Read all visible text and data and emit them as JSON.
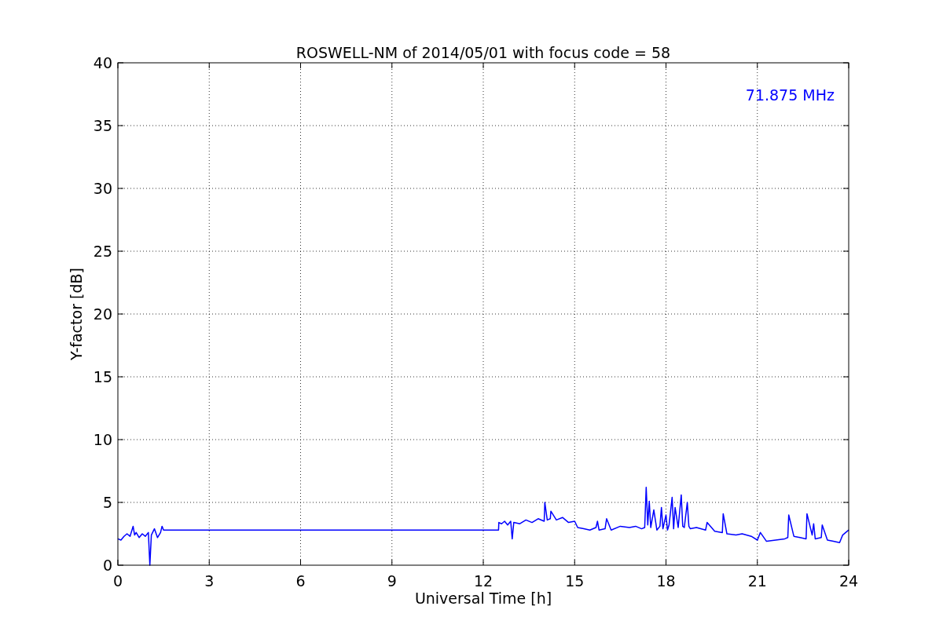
{
  "chart_data": {
    "type": "line",
    "title": "ROSWELL-NM of 2014/05/01 with focus code = 58",
    "xlabel": "Universal Time [h]",
    "ylabel": "Y-factor [dB]",
    "x": [
      0,
      0.1,
      0.2,
      0.3,
      0.4,
      0.5,
      0.55,
      0.6,
      0.7,
      0.8,
      0.9,
      1.0,
      1.05,
      1.1,
      1.2,
      1.3,
      1.4,
      1.45,
      1.5,
      12.5,
      12.51,
      12.6,
      12.7,
      12.8,
      12.9,
      12.95,
      13.0,
      13.2,
      13.4,
      13.6,
      13.8,
      14.0,
      14.02,
      14.1,
      14.2,
      14.22,
      14.4,
      14.6,
      14.8,
      15.0,
      15.1,
      15.3,
      15.5,
      15.7,
      15.75,
      15.8,
      16.0,
      16.05,
      16.2,
      16.5,
      16.8,
      17.0,
      17.2,
      17.3,
      17.35,
      17.4,
      17.45,
      17.5,
      17.6,
      17.7,
      17.8,
      17.85,
      17.9,
      18.0,
      18.05,
      18.1,
      18.2,
      18.25,
      18.3,
      18.4,
      18.5,
      18.55,
      18.6,
      18.7,
      18.75,
      18.8,
      19.0,
      19.3,
      19.35,
      19.6,
      19.85,
      19.88,
      20.0,
      20.3,
      20.5,
      20.8,
      21.0,
      21.1,
      21.3,
      21.6,
      21.9,
      22.0,
      22.03,
      22.2,
      22.4,
      22.6,
      22.63,
      22.8,
      22.85,
      22.9,
      23.1,
      23.13,
      23.3,
      23.5,
      23.7,
      23.8,
      24.0
    ],
    "series": [
      {
        "name": "71.875 MHz",
        "color": "#0000ff",
        "values": [
          2.1,
          2.0,
          2.3,
          2.5,
          2.3,
          3.1,
          2.4,
          2.6,
          2.2,
          2.5,
          2.3,
          2.6,
          0,
          2.4,
          2.9,
          2.2,
          2.6,
          3.1,
          2.8,
          2.8,
          3.4,
          3.3,
          3.5,
          3.2,
          3.5,
          2.1,
          3.4,
          3.3,
          3.6,
          3.4,
          3.7,
          3.5,
          5.0,
          3.6,
          3.7,
          4.3,
          3.6,
          3.8,
          3.4,
          3.5,
          3.0,
          2.9,
          2.8,
          3.0,
          3.5,
          2.8,
          2.9,
          3.7,
          2.8,
          3.1,
          3.0,
          3.1,
          2.9,
          3.0,
          6.2,
          3.2,
          5.1,
          3.0,
          4.4,
          2.8,
          3.1,
          4.6,
          2.9,
          4.0,
          2.8,
          3.2,
          5.4,
          2.9,
          4.6,
          3.0,
          5.6,
          3.1,
          3.0,
          5.0,
          3.1,
          2.9,
          3.0,
          2.8,
          3.4,
          2.7,
          2.6,
          4.1,
          2.5,
          2.4,
          2.5,
          2.3,
          2.0,
          2.6,
          1.9,
          2.0,
          2.1,
          2.2,
          4.0,
          2.3,
          2.2,
          2.1,
          4.1,
          2.4,
          3.3,
          2.1,
          2.2,
          3.2,
          2.0,
          1.9,
          1.8,
          2.4,
          2.8
        ]
      }
    ],
    "xlim": [
      0,
      24
    ],
    "ylim": [
      0,
      40
    ],
    "xticks": [
      0,
      3,
      6,
      9,
      12,
      15,
      18,
      21,
      24
    ],
    "yticks": [
      0,
      5,
      10,
      15,
      20,
      25,
      30,
      35,
      40
    ],
    "grid": true
  }
}
